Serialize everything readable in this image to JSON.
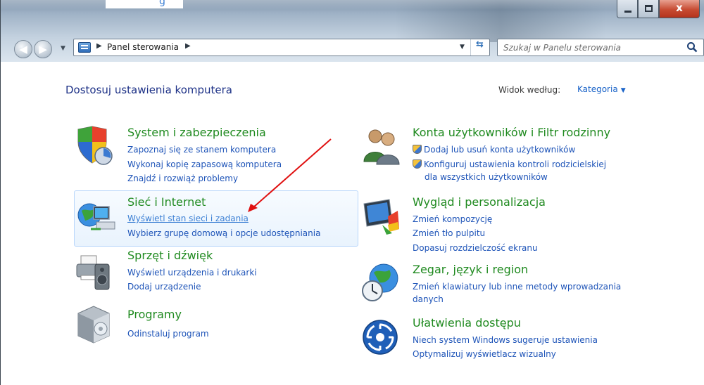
{
  "window": {
    "peek_text": "g",
    "minimize_glyph": "",
    "close_glyph": "x"
  },
  "address_bar": {
    "breadcrumb": "Panel sterowania",
    "separator": "▶"
  },
  "search": {
    "placeholder": "Szukaj w Panelu sterowania"
  },
  "header": {
    "title": "Dostosuj ustawienia komputera",
    "view_by_label": "Widok według:",
    "view_by_value": "Kategoria"
  },
  "categories": {
    "system": {
      "title": "System i zabezpieczenia",
      "links": [
        "Zapoznaj się ze stanem komputera",
        "Wykonaj kopię zapasową komputera",
        "Znajdź i rozwiąż problemy"
      ]
    },
    "network": {
      "title": "Sieć i Internet",
      "links": [
        "Wyświetl stan sieci i zadania",
        "Wybierz grupę domową i opcje udostępniania"
      ]
    },
    "hardware": {
      "title": "Sprzęt i dźwięk",
      "links": [
        "Wyświetl urządzenia i drukarki",
        "Dodaj urządzenie"
      ]
    },
    "programs": {
      "title": "Programy",
      "links": [
        "Odinstaluj program"
      ]
    },
    "accounts": {
      "title": "Konta użytkowników i Filtr rodzinny",
      "links": [
        "Dodaj lub usuń konta użytkowników",
        "Konfiguruj ustawienia kontroli rodzicielskiej",
        "dla wszystkich użytkowników"
      ]
    },
    "appearance": {
      "title": "Wygląd i personalizacja",
      "links": [
        "Zmień kompozycję",
        "Zmień tło pulpitu",
        "Dopasuj rozdzielczość ekranu"
      ]
    },
    "clock": {
      "title": "Zegar, język i region",
      "links": [
        "Zmień klawiatury lub inne metody wprowadzania",
        "danych"
      ]
    },
    "ease": {
      "title": "Ułatwienia dostępu",
      "links": [
        "Niech system Windows sugeruje ustawienia",
        "Optymalizuj wyświetlacz wizualny"
      ]
    }
  },
  "colors": {
    "category_title": "#1f8a1f",
    "link": "#1e54b8",
    "heading": "#1e3287",
    "annotation_arrow": "#e01010"
  }
}
